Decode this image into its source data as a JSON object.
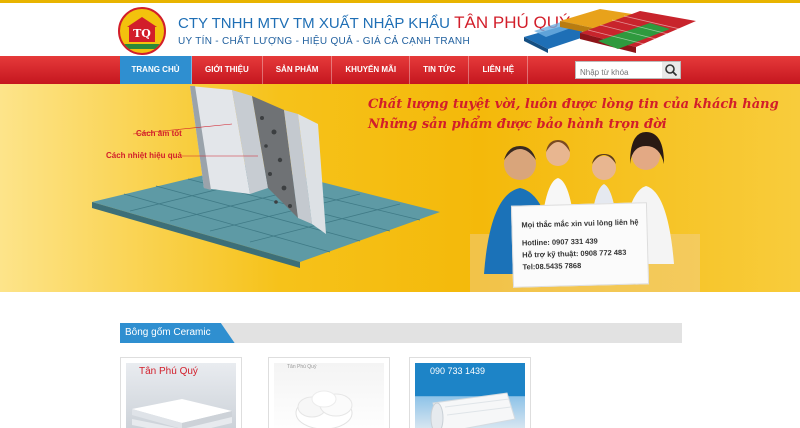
{
  "header": {
    "company_prefix": "CTY TNHH MTV TM XUẤT NHẬP KHẨU",
    "company_brand": "TÂN PHÚ QUÝ",
    "slogan": "UY TÍN - CHẤT LƯỢNG - HIỆU QUẢ - GIÁ CẢ CẠNH TRANH",
    "logo_text": "TQ"
  },
  "nav": {
    "items": [
      {
        "label": "TRANG CHỦ"
      },
      {
        "label": "GIỚI THIỆU"
      },
      {
        "label": "SẢN PHẨM"
      },
      {
        "label": "KHUYẾN MÃI"
      },
      {
        "label": "TIN TỨC"
      },
      {
        "label": "LIÊN HỆ"
      }
    ],
    "active_index": 0
  },
  "search": {
    "placeholder": "Nhập từ khóa"
  },
  "banner": {
    "line1": "Chất lượng tuyệt vời, luôn được lòng tin của khách hàng",
    "line2": "Những sản phẩm được bảo hành trọn đời",
    "tag1": "Cách âm tốt",
    "tag2": "Cách nhiệt hiệu quả",
    "card": {
      "heading": "Mọi thắc mắc xin vui lòng liên hệ",
      "hotline": "Hotline: 0907 331 439",
      "support": "Hỗ trợ kỹ thuật: 0908 772 483",
      "tel": "Tel:08.5435 7868"
    }
  },
  "section": {
    "title": "Bông gốm Ceramic",
    "products": [
      {
        "label": "Tân Phú Quý"
      },
      {
        "label": "Tân Phú Quý"
      },
      {
        "label": "090 733 1439"
      }
    ]
  },
  "colors": {
    "accent_red": "#d21e2a",
    "nav_blue": "#2f8fd0",
    "banner_yellow": "#f4b90a"
  }
}
